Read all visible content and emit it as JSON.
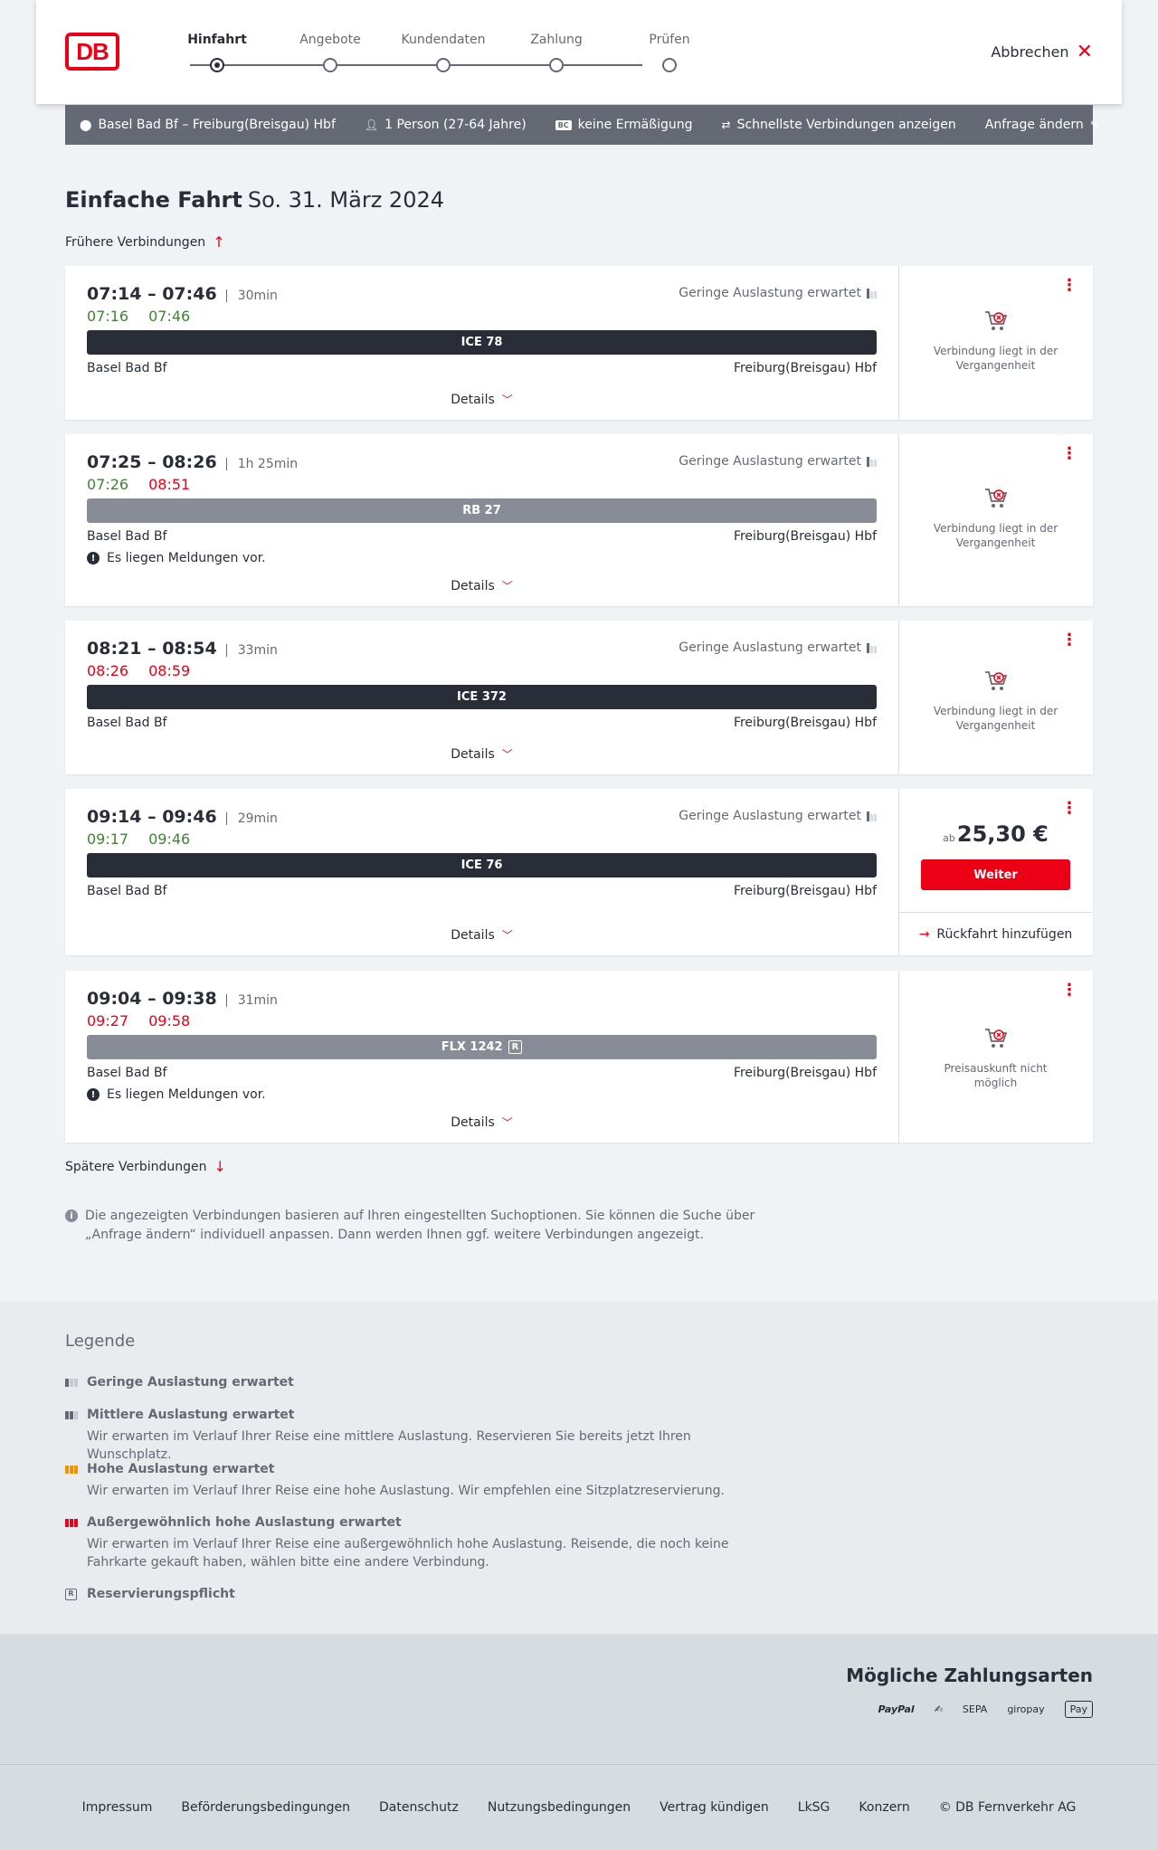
{
  "header": {
    "logo": "DB",
    "steps": [
      "Hinfahrt",
      "Angebote",
      "Kundendaten",
      "Zahlung",
      "Prüfen"
    ],
    "active_step": "Hinfahrt",
    "cancel_label": "Abbrechen"
  },
  "query": {
    "route": "Basel Bad Bf – Freiburg(Breisgau) Hbf",
    "persons": "1 Person (27-64 Jahre)",
    "discount_badge": "BC",
    "discount": "keine Ermäßigung",
    "fastest": "Schnellste Verbindungen anzeigen",
    "change": "Anfrage ändern"
  },
  "title": {
    "main": "Einfache Fahrt",
    "date": "So. 31. März 2024"
  },
  "earlier": "Frühere Verbindungen",
  "later": "Spätere Verbindungen",
  "connections": [
    {
      "times": "07:14 – 07:46",
      "duration": "30min",
      "rt_dep": "07:16",
      "rt_arr": "07:46",
      "rt_dep_color": "green",
      "rt_arr_color": "green",
      "load": "Geringe Auslastung erwartet",
      "train": "ICE 78",
      "train_style": "dark",
      "from": "Basel Bad Bf",
      "to": "Freiburg(Breisgau) Hbf",
      "message": "",
      "details": "Details",
      "side_text": "Verbindung liegt in der Vergangenheit"
    },
    {
      "times": "07:25 – 08:26",
      "duration": "1h 25min",
      "rt_dep": "07:26",
      "rt_arr": "08:51",
      "rt_dep_color": "green",
      "rt_arr_color": "red",
      "load": "Geringe Auslastung erwartet",
      "train": "RB 27",
      "train_style": "grey",
      "from": "Basel Bad Bf",
      "to": "Freiburg(Breisgau) Hbf",
      "message": "Es liegen Meldungen vor.",
      "details": "Details",
      "side_text": "Verbindung liegt in der Vergangenheit"
    },
    {
      "times": "08:21 – 08:54",
      "duration": "33min",
      "rt_dep": "08:26",
      "rt_arr": "08:59",
      "rt_dep_color": "red",
      "rt_arr_color": "red",
      "load": "Geringe Auslastung erwartet",
      "train": "ICE 372",
      "train_style": "dark",
      "from": "Basel Bad Bf",
      "to": "Freiburg(Breisgau) Hbf",
      "message": "",
      "details": "Details",
      "side_text": "Verbindung liegt in der Vergangenheit"
    },
    {
      "times": "09:14 – 09:46",
      "duration": "29min",
      "rt_dep": "09:17",
      "rt_arr": "09:46",
      "rt_dep_color": "green",
      "rt_arr_color": "green",
      "load": "Geringe Auslastung erwartet",
      "train": "ICE 76",
      "train_style": "dark",
      "from": "Basel Bad Bf",
      "to": "Freiburg(Breisgau) Hbf",
      "message": "",
      "details": "Details",
      "price_prefix": "ab",
      "price": "25,30 €",
      "button": "Weiter",
      "return_label": "Rückfahrt hinzufügen"
    },
    {
      "times": "09:04 – 09:38",
      "duration": "31min",
      "rt_dep": "09:27",
      "rt_arr": "09:58",
      "rt_dep_color": "red",
      "rt_arr_color": "red",
      "load": "",
      "train": "FLX 1242",
      "train_style": "grey",
      "train_badge": "R",
      "from": "Basel Bad Bf",
      "to": "Freiburg(Breisgau) Hbf",
      "message": "Es liegen Meldungen vor.",
      "details": "Details",
      "side_text": "Preisauskunft nicht möglich"
    }
  ],
  "info": "Die angezeigten Verbindungen basieren auf Ihren eingestellten Suchoptionen. Sie können die Suche über „Anfrage ändern“ individuell anpassen. Dann werden Ihnen ggf. weitere Verbindungen angezeigt.",
  "legend": {
    "title": "Legende",
    "items": [
      {
        "title": "Geringe Auslastung erwartet",
        "desc": ""
      },
      {
        "title": "Mittlere Auslastung erwartet",
        "desc": "Wir erwarten im Verlauf Ihrer Reise eine mittlere Auslastung. Reservieren Sie bereits jetzt Ihren Wunschplatz."
      },
      {
        "title": "Hohe Auslastung erwartet",
        "desc": "Wir erwarten im Verlauf Ihrer Reise eine hohe Auslastung. Wir empfehlen eine Sitzplatzreservierung."
      },
      {
        "title": "Außergewöhnlich hohe Auslastung erwartet",
        "desc": "Wir erwarten im Verlauf Ihrer Reise eine außergewöhnlich hohe Auslastung. Reisende, die noch keine Fahrkarte gekauft haben, wählen bitte eine andere Verbindung."
      },
      {
        "title": "Reservierungspflicht",
        "desc": "",
        "badge": "R"
      }
    ]
  },
  "payment": {
    "title": "Mögliche Zahlungsarten",
    "methods": [
      "PayPal",
      "SEPA",
      "giropay",
      "Pay"
    ]
  },
  "footer": [
    "Impressum",
    "Beförderungsbedingungen",
    "Datenschutz",
    "Nutzungsbedingungen",
    "Vertrag kündigen",
    "LkSG",
    "Konzern",
    "© DB Fernverkehr AG"
  ],
  "colors": {
    "brand": "#ec0016",
    "ontime": "#408335",
    "delay": "#ec0016",
    "query_bar": "#646973",
    "train_dark": "#282d37",
    "train_grey": "#878c96"
  }
}
